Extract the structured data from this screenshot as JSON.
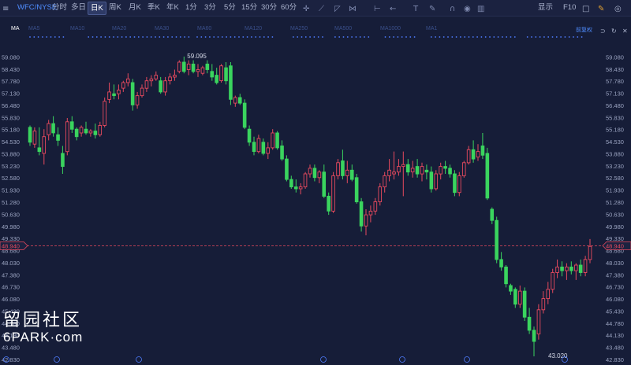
{
  "toolbar": {
    "symbol": "WFC/NYSE",
    "periods": [
      "分时",
      "多日",
      "日K",
      "周K",
      "月K",
      "季K",
      "年K",
      "1分",
      "3分",
      "5分",
      "15分",
      "30分",
      "60分"
    ],
    "active_period": "日K",
    "display_label": "显示",
    "f10_label": "F10",
    "icons": [
      "crosshair-icon",
      "line-tool-icon",
      "channel-tool-icon",
      "fibonacci-tool-icon",
      "measure-tool-icon",
      "arrow-tool-icon",
      "text-tool-icon",
      "brush-icon",
      "magnet-icon",
      "eye-icon",
      "trash-icon"
    ]
  },
  "ma_bar": {
    "label": "MA",
    "items": [
      "MA5",
      "MA10",
      "MA20",
      "MA30",
      "MA60",
      "MA120",
      "MA250",
      "MA500",
      "MA1000",
      "MA1"
    ],
    "restore_label": "前复权"
  },
  "chart_data": {
    "type": "candlestick",
    "ylim": [
      42.83,
      59.73
    ],
    "y_ticks": [
      "59.080",
      "58.430",
      "57.780",
      "57.130",
      "56.480",
      "55.830",
      "55.180",
      "54.530",
      "53.880",
      "53.230",
      "52.580",
      "51.930",
      "51.280",
      "50.630",
      "49.980",
      "49.330",
      "48.680",
      "48.030",
      "47.380",
      "46.730",
      "46.080",
      "45.430",
      "44.780",
      "44.130",
      "43.480",
      "42.830"
    ],
    "current_price": "48.940",
    "high_label": "59.095",
    "low_label": "43.020",
    "up_color": "#e74a5e",
    "down_color": "#3ad45e",
    "candles": [
      {
        "o": 55.3,
        "h": 55.4,
        "l": 54.3,
        "c": 54.5
      },
      {
        "o": 54.4,
        "h": 55.3,
        "l": 54.2,
        "c": 55.1
      },
      {
        "o": 54.2,
        "h": 55.3,
        "l": 53.8,
        "c": 54.0
      },
      {
        "o": 53.9,
        "h": 55.2,
        "l": 53.3,
        "c": 54.8
      },
      {
        "o": 54.9,
        "h": 55.7,
        "l": 54.6,
        "c": 55.5
      },
      {
        "o": 55.5,
        "h": 55.9,
        "l": 54.8,
        "c": 55.0
      },
      {
        "o": 54.9,
        "h": 55.3,
        "l": 54.3,
        "c": 54.6
      },
      {
        "o": 53.9,
        "h": 54.3,
        "l": 52.8,
        "c": 53.2
      },
      {
        "o": 54.0,
        "h": 55.8,
        "l": 53.8,
        "c": 55.6
      },
      {
        "o": 55.6,
        "h": 55.9,
        "l": 55.0,
        "c": 55.2
      },
      {
        "o": 55.2,
        "h": 55.3,
        "l": 54.6,
        "c": 54.8
      },
      {
        "o": 55.0,
        "h": 55.4,
        "l": 54.8,
        "c": 55.3
      },
      {
        "o": 55.2,
        "h": 55.6,
        "l": 54.9,
        "c": 55.0
      },
      {
        "o": 55.0,
        "h": 55.2,
        "l": 54.8,
        "c": 55.1
      },
      {
        "o": 55.1,
        "h": 55.5,
        "l": 54.7,
        "c": 54.9
      },
      {
        "o": 54.9,
        "h": 55.6,
        "l": 54.8,
        "c": 55.4
      },
      {
        "o": 55.4,
        "h": 56.9,
        "l": 55.3,
        "c": 56.7
      },
      {
        "o": 56.8,
        "h": 57.7,
        "l": 56.6,
        "c": 57.2
      },
      {
        "o": 57.1,
        "h": 57.6,
        "l": 56.8,
        "c": 57.0
      },
      {
        "o": 57.1,
        "h": 57.6,
        "l": 56.8,
        "c": 57.3
      },
      {
        "o": 57.4,
        "h": 57.8,
        "l": 57.2,
        "c": 57.7
      },
      {
        "o": 57.7,
        "h": 58.2,
        "l": 57.5,
        "c": 57.9
      },
      {
        "o": 57.7,
        "h": 57.9,
        "l": 56.2,
        "c": 56.5
      },
      {
        "o": 56.5,
        "h": 57.2,
        "l": 56.3,
        "c": 57.0
      },
      {
        "o": 57.0,
        "h": 57.6,
        "l": 56.9,
        "c": 57.4
      },
      {
        "o": 57.4,
        "h": 58.0,
        "l": 57.2,
        "c": 57.8
      },
      {
        "o": 57.8,
        "h": 58.1,
        "l": 57.5,
        "c": 57.9
      },
      {
        "o": 57.9,
        "h": 58.3,
        "l": 57.8,
        "c": 58.1
      },
      {
        "o": 57.8,
        "h": 58.0,
        "l": 57.1,
        "c": 57.2
      },
      {
        "o": 57.2,
        "h": 58.0,
        "l": 57.0,
        "c": 57.8
      },
      {
        "o": 57.8,
        "h": 58.2,
        "l": 57.6,
        "c": 58.0
      },
      {
        "o": 58.0,
        "h": 58.4,
        "l": 57.8,
        "c": 58.1
      },
      {
        "o": 58.3,
        "h": 58.9,
        "l": 58.2,
        "c": 58.8
      },
      {
        "o": 58.8,
        "h": 59.1,
        "l": 58.2,
        "c": 58.3
      },
      {
        "o": 58.4,
        "h": 58.9,
        "l": 58.1,
        "c": 58.7
      },
      {
        "o": 58.7,
        "h": 58.9,
        "l": 58.2,
        "c": 58.3
      },
      {
        "o": 58.3,
        "h": 58.7,
        "l": 58.0,
        "c": 58.4
      },
      {
        "o": 58.2,
        "h": 58.6,
        "l": 58.1,
        "c": 58.5
      },
      {
        "o": 58.7,
        "h": 58.9,
        "l": 58.2,
        "c": 58.4
      },
      {
        "o": 58.3,
        "h": 58.7,
        "l": 57.8,
        "c": 58.0
      },
      {
        "o": 58.1,
        "h": 58.5,
        "l": 57.6,
        "c": 57.7
      },
      {
        "o": 57.8,
        "h": 58.7,
        "l": 57.7,
        "c": 58.6
      },
      {
        "o": 58.5,
        "h": 58.8,
        "l": 57.6,
        "c": 57.8
      },
      {
        "o": 58.6,
        "h": 58.8,
        "l": 56.5,
        "c": 56.8
      },
      {
        "o": 56.6,
        "h": 57.0,
        "l": 56.4,
        "c": 56.9
      },
      {
        "o": 56.9,
        "h": 57.1,
        "l": 56.5,
        "c": 56.6
      },
      {
        "o": 56.6,
        "h": 56.8,
        "l": 55.2,
        "c": 55.3
      },
      {
        "o": 55.2,
        "h": 55.4,
        "l": 54.3,
        "c": 54.5
      },
      {
        "o": 54.5,
        "h": 54.8,
        "l": 53.8,
        "c": 54.0
      },
      {
        "o": 54.0,
        "h": 54.9,
        "l": 53.9,
        "c": 54.7
      },
      {
        "o": 54.5,
        "h": 54.7,
        "l": 53.8,
        "c": 53.9
      },
      {
        "o": 53.9,
        "h": 54.5,
        "l": 53.6,
        "c": 54.2
      },
      {
        "o": 54.2,
        "h": 55.2,
        "l": 54.1,
        "c": 55.0
      },
      {
        "o": 55.0,
        "h": 55.1,
        "l": 54.1,
        "c": 54.2
      },
      {
        "o": 54.3,
        "h": 54.6,
        "l": 53.5,
        "c": 53.6
      },
      {
        "o": 53.6,
        "h": 53.8,
        "l": 52.4,
        "c": 52.5
      },
      {
        "o": 52.5,
        "h": 52.7,
        "l": 52.0,
        "c": 52.1
      },
      {
        "o": 52.1,
        "h": 52.5,
        "l": 51.8,
        "c": 52.0
      },
      {
        "o": 52.0,
        "h": 52.3,
        "l": 51.7,
        "c": 52.1
      },
      {
        "o": 52.1,
        "h": 52.9,
        "l": 52.0,
        "c": 52.8
      },
      {
        "o": 52.8,
        "h": 53.3,
        "l": 52.6,
        "c": 53.1
      },
      {
        "o": 53.1,
        "h": 53.3,
        "l": 52.4,
        "c": 52.6
      },
      {
        "o": 52.6,
        "h": 53.0,
        "l": 52.3,
        "c": 52.9
      },
      {
        "o": 52.9,
        "h": 53.3,
        "l": 51.5,
        "c": 51.6
      },
      {
        "o": 51.6,
        "h": 51.8,
        "l": 50.6,
        "c": 50.8
      },
      {
        "o": 50.8,
        "h": 52.9,
        "l": 50.7,
        "c": 52.7
      },
      {
        "o": 52.7,
        "h": 53.6,
        "l": 52.5,
        "c": 53.4
      },
      {
        "o": 53.5,
        "h": 54.1,
        "l": 52.5,
        "c": 52.7
      },
      {
        "o": 52.7,
        "h": 53.5,
        "l": 52.3,
        "c": 53.0
      },
      {
        "o": 53.0,
        "h": 53.3,
        "l": 52.4,
        "c": 52.5
      },
      {
        "o": 52.6,
        "h": 52.8,
        "l": 51.2,
        "c": 51.3
      },
      {
        "o": 51.3,
        "h": 51.5,
        "l": 49.7,
        "c": 50.0
      },
      {
        "o": 50.0,
        "h": 50.9,
        "l": 49.5,
        "c": 50.6
      },
      {
        "o": 50.6,
        "h": 51.1,
        "l": 50.2,
        "c": 50.8
      },
      {
        "o": 50.8,
        "h": 51.5,
        "l": 50.6,
        "c": 51.3
      },
      {
        "o": 51.3,
        "h": 52.3,
        "l": 51.1,
        "c": 52.1
      },
      {
        "o": 52.1,
        "h": 52.9,
        "l": 51.8,
        "c": 52.7
      },
      {
        "o": 52.7,
        "h": 53.6,
        "l": 52.4,
        "c": 53.0
      },
      {
        "o": 52.8,
        "h": 54.0,
        "l": 52.5,
        "c": 52.9
      },
      {
        "o": 52.9,
        "h": 53.6,
        "l": 52.7,
        "c": 53.2
      },
      {
        "o": 53.2,
        "h": 54.0,
        "l": 51.6,
        "c": 53.3
      },
      {
        "o": 53.3,
        "h": 53.6,
        "l": 52.7,
        "c": 52.9
      },
      {
        "o": 52.9,
        "h": 53.5,
        "l": 52.6,
        "c": 53.1
      },
      {
        "o": 53.2,
        "h": 53.6,
        "l": 52.6,
        "c": 52.8
      },
      {
        "o": 52.8,
        "h": 53.4,
        "l": 52.4,
        "c": 53.2
      },
      {
        "o": 53.0,
        "h": 53.3,
        "l": 52.5,
        "c": 52.9
      },
      {
        "o": 52.9,
        "h": 53.2,
        "l": 51.8,
        "c": 52.0
      },
      {
        "o": 52.0,
        "h": 53.0,
        "l": 51.9,
        "c": 52.8
      },
      {
        "o": 52.8,
        "h": 53.4,
        "l": 52.5,
        "c": 53.2
      },
      {
        "o": 53.2,
        "h": 53.5,
        "l": 52.8,
        "c": 53.1
      },
      {
        "o": 53.1,
        "h": 53.3,
        "l": 52.6,
        "c": 52.8
      },
      {
        "o": 52.8,
        "h": 53.0,
        "l": 51.6,
        "c": 51.8
      },
      {
        "o": 51.8,
        "h": 52.9,
        "l": 51.6,
        "c": 52.7
      },
      {
        "o": 52.7,
        "h": 53.5,
        "l": 52.6,
        "c": 53.4
      },
      {
        "o": 53.4,
        "h": 54.3,
        "l": 53.3,
        "c": 54.1
      },
      {
        "o": 54.1,
        "h": 54.6,
        "l": 53.4,
        "c": 53.6
      },
      {
        "o": 53.7,
        "h": 54.4,
        "l": 53.5,
        "c": 54.0
      },
      {
        "o": 54.3,
        "h": 55.0,
        "l": 53.6,
        "c": 53.8
      },
      {
        "o": 53.9,
        "h": 54.2,
        "l": 51.4,
        "c": 51.5
      },
      {
        "o": 50.9,
        "h": 51.0,
        "l": 50.1,
        "c": 50.3
      },
      {
        "o": 50.3,
        "h": 50.5,
        "l": 48.0,
        "c": 48.2
      },
      {
        "o": 48.2,
        "h": 48.6,
        "l": 47.6,
        "c": 47.8
      },
      {
        "o": 47.8,
        "h": 47.9,
        "l": 46.7,
        "c": 46.9
      },
      {
        "o": 46.8,
        "h": 46.9,
        "l": 46.3,
        "c": 46.5
      },
      {
        "o": 46.6,
        "h": 46.7,
        "l": 45.6,
        "c": 45.8
      },
      {
        "o": 45.8,
        "h": 46.8,
        "l": 45.6,
        "c": 46.5
      },
      {
        "o": 46.5,
        "h": 46.7,
        "l": 44.9,
        "c": 45.1
      },
      {
        "o": 45.1,
        "h": 45.6,
        "l": 44.2,
        "c": 44.4
      },
      {
        "o": 44.4,
        "h": 44.6,
        "l": 43.0,
        "c": 43.8
      },
      {
        "o": 44.2,
        "h": 45.8,
        "l": 43.9,
        "c": 45.5
      },
      {
        "o": 45.5,
        "h": 46.5,
        "l": 45.3,
        "c": 46.1
      },
      {
        "o": 46.1,
        "h": 47.0,
        "l": 45.8,
        "c": 46.6
      },
      {
        "o": 46.6,
        "h": 47.7,
        "l": 46.4,
        "c": 47.5
      },
      {
        "o": 47.5,
        "h": 48.2,
        "l": 47.2,
        "c": 47.8
      },
      {
        "o": 47.8,
        "h": 48.1,
        "l": 47.3,
        "c": 47.6
      },
      {
        "o": 47.6,
        "h": 48.0,
        "l": 47.1,
        "c": 47.8
      },
      {
        "o": 47.8,
        "h": 48.1,
        "l": 47.4,
        "c": 47.6
      },
      {
        "o": 47.6,
        "h": 48.0,
        "l": 47.1,
        "c": 47.9
      },
      {
        "o": 47.9,
        "h": 48.2,
        "l": 47.3,
        "c": 47.5
      },
      {
        "o": 47.5,
        "h": 48.4,
        "l": 47.3,
        "c": 48.2
      },
      {
        "o": 48.2,
        "h": 49.3,
        "l": 48.0,
        "c": 48.9
      }
    ]
  },
  "watermark": {
    "cn": "留园社区",
    "en": "6PARK·com"
  }
}
